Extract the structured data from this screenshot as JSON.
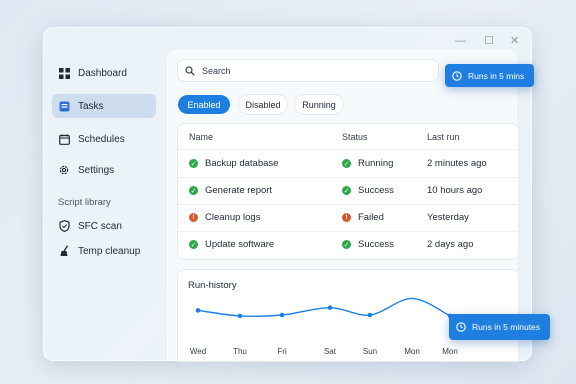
{
  "window": {
    "minimize_glyph": "—",
    "maximize_glyph": "☐",
    "close_glyph": "✕"
  },
  "sidebar": {
    "items": [
      {
        "label": "Dashboard",
        "icon": "grid-icon",
        "active": false
      },
      {
        "label": "Tasks",
        "icon": "task-icon",
        "active": true
      },
      {
        "label": "Schedules",
        "icon": "calendar-icon",
        "active": false
      },
      {
        "label": "Settings",
        "icon": "gear-icon",
        "active": false
      }
    ],
    "section_label": "Script library",
    "scripts": [
      {
        "label": "SFC scan",
        "icon": "shield-icon"
      },
      {
        "label": "Temp cleanup",
        "icon": "broom-icon"
      }
    ]
  },
  "search": {
    "placeholder": "Search"
  },
  "filters": [
    {
      "label": "Enabled",
      "active": true
    },
    {
      "label": "Disabled",
      "active": false
    },
    {
      "label": "Running",
      "active": false
    }
  ],
  "table": {
    "headers": [
      "Name",
      "Status",
      "Last run"
    ],
    "rows": [
      {
        "name": "Backup database",
        "status": "Running",
        "last_run": "2 minutes ago",
        "state": "ok"
      },
      {
        "name": "Generate report",
        "status": "Success",
        "last_run": "10 hours ago",
        "state": "ok"
      },
      {
        "name": "Cleanup logs",
        "status": "Failed",
        "last_run": "Yesterday",
        "state": "error"
      },
      {
        "name": "Update software",
        "status": "Success",
        "last_run": "2 days ago",
        "state": "ok"
      }
    ]
  },
  "chart": {
    "title": "Run-history",
    "chart_data": {
      "type": "line",
      "categories": [
        "Wed",
        "Thu",
        "Fri",
        "Sat",
        "Sun",
        "Mon",
        "Mon"
      ],
      "values": [
        3.0,
        2.4,
        2.5,
        3.3,
        2.5,
        4.3,
        2.4
      ],
      "ylim": [
        0,
        5
      ],
      "grid": false,
      "line_color": "#1e7fe0"
    }
  },
  "toasts": {
    "top": "Runs in 5 mins",
    "bottom": "Runs in 5 minutes"
  },
  "colors": {
    "accent": "#1e7fe0",
    "success": "#2aa84a",
    "error": "#d9562a"
  }
}
